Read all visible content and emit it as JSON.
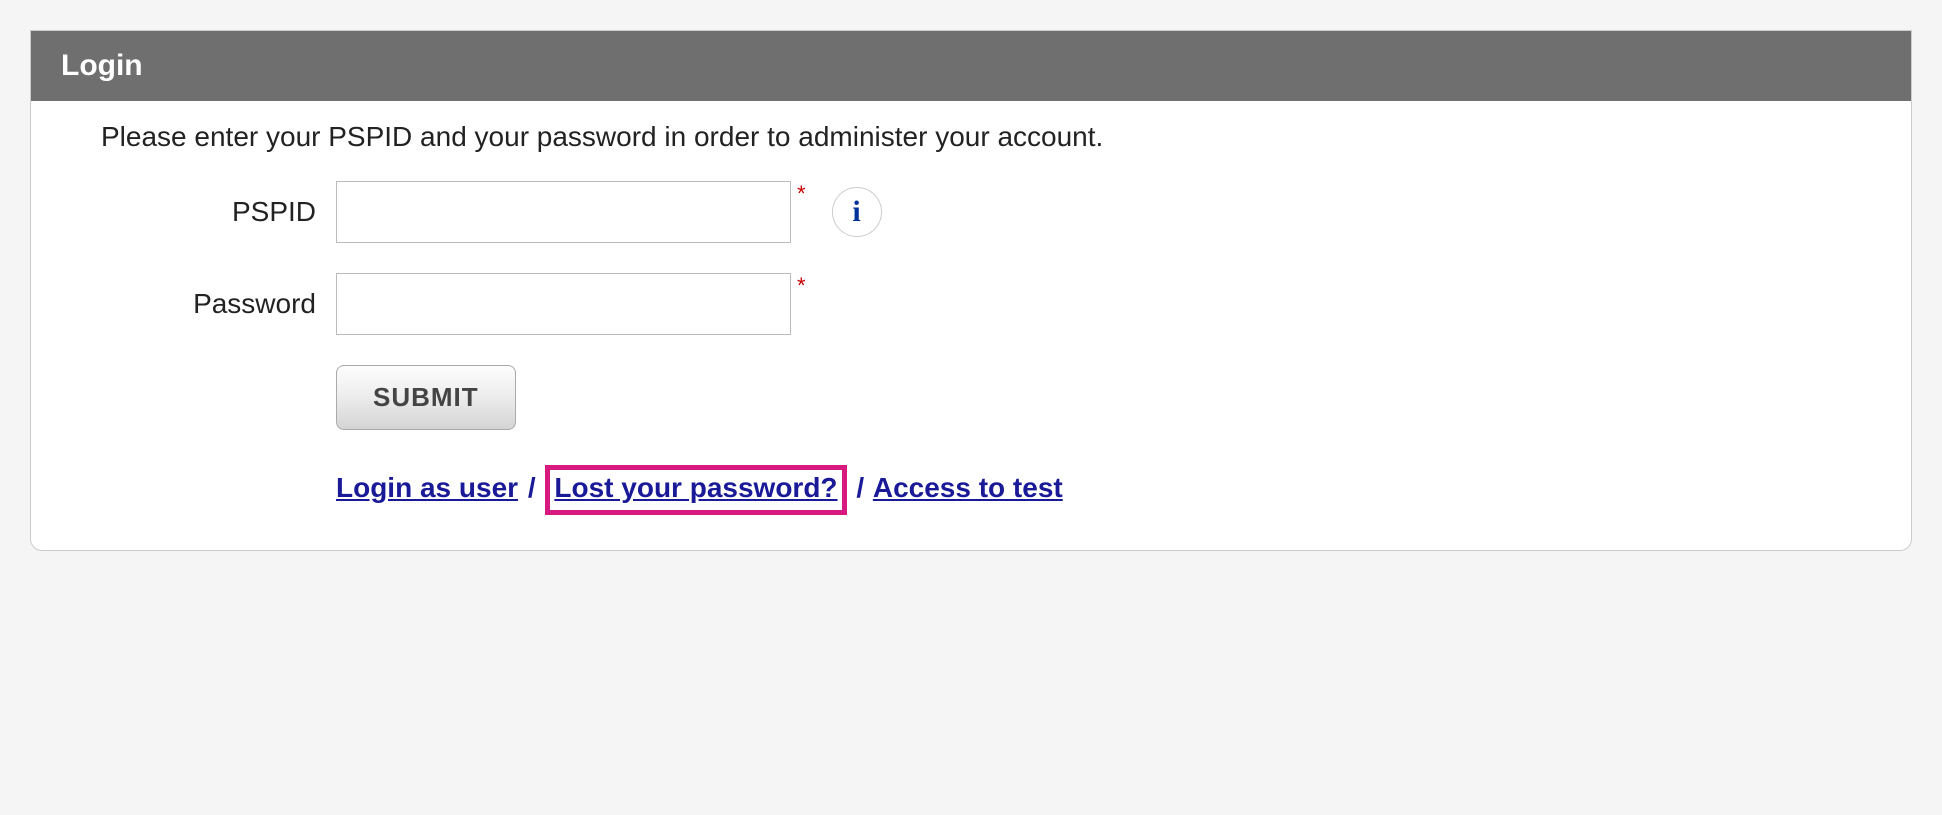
{
  "panel": {
    "title": "Login",
    "instruction": "Please enter your PSPID and your password in order to administer your account.",
    "fields": {
      "pspid": {
        "label": "PSPID",
        "value": "",
        "required_mark": "*"
      },
      "password": {
        "label": "Password",
        "value": "",
        "required_mark": "*"
      }
    },
    "info_icon_glyph": "i",
    "submit_label": "SUBMIT",
    "links": {
      "login_as_user": "Login as user",
      "lost_password": "Lost your password?",
      "access_to_test": "Access to test",
      "separator": "/"
    }
  }
}
